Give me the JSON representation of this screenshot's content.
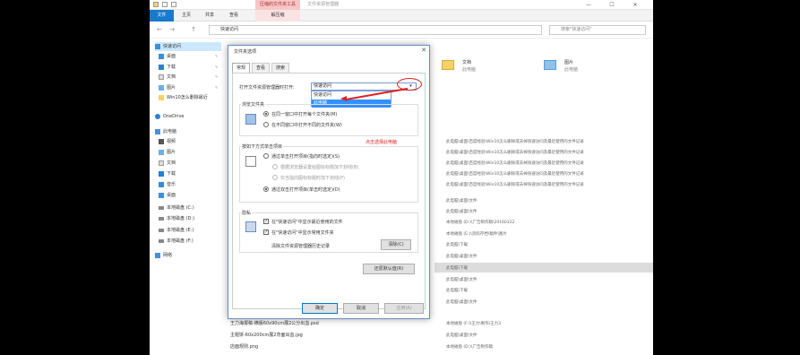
{
  "window": {
    "title": "文件资源管理器",
    "context_tab": "压缩的文件夹工具",
    "min": "—",
    "max": "☐",
    "close": "✕"
  },
  "ribbon": {
    "tabs": [
      "文件",
      "主页",
      "共享",
      "查看",
      "解压缩"
    ]
  },
  "nav": {
    "back": "←",
    "forward": "→",
    "up": "↑",
    "address": "快速访问",
    "search_placeholder": "搜索\"快速访问\""
  },
  "sidebar": {
    "items": [
      {
        "label": "快速访问",
        "pinned": false
      },
      {
        "label": "桌面",
        "pinned": true
      },
      {
        "label": "下载",
        "pinned": true
      },
      {
        "label": "文档",
        "pinned": true
      },
      {
        "label": "图片",
        "pinned": true
      },
      {
        "label": "Win10怎么删除最近",
        "pinned": false
      },
      {
        "label": "OneDrive",
        "pinned": false
      },
      {
        "label": "此电脑",
        "pinned": false
      },
      {
        "label": "视频",
        "pinned": false
      },
      {
        "label": "图片",
        "pinned": false
      },
      {
        "label": "文档",
        "pinned": false
      },
      {
        "label": "下载",
        "pinned": false
      },
      {
        "label": "音乐",
        "pinned": false
      },
      {
        "label": "桌面",
        "pinned": false
      },
      {
        "label": "本地磁盘 (C:)",
        "pinned": false
      },
      {
        "label": "本地磁盘 (D:)",
        "pinned": false
      },
      {
        "label": "本地磁盘 (E:)",
        "pinned": false
      },
      {
        "label": "本地磁盘 (F:)",
        "pinned": false
      },
      {
        "label": "网络",
        "pinned": false
      }
    ]
  },
  "content": {
    "folders": [
      {
        "label": "文档",
        "sub": "此电脑"
      },
      {
        "label": "图片",
        "sub": "此电脑"
      }
    ],
    "paths": [
      "此电脑\\桌面\\百度经验\\Win10怎么删除或去掉快速访问及最近使用的文件记录",
      "此电脑\\桌面\\百度经验\\Win10怎么删除或去掉快速访问及最近使用的文件记录",
      "此电脑\\桌面\\百度经验\\Win10怎么删除或去掉快速访问及最近使用的文件记录",
      "此电脑\\桌面\\百度经验\\Win10怎么删除或去掉快速访问及最近使用的文件记录",
      "此电脑\\桌面\\百度经验\\Win10怎么删除或去掉快速访问及最近使用的文件记录",
      "此电脑\\桌面\\文件",
      "此电脑\\桌面\\文件",
      "本地磁盘 (D:)\\广告制作稿\\20160322",
      "本地磁盘 (E:)\\资料存档\\稿件\\图片",
      "此电脑\\下载",
      "此电脑\\桌面\\文件",
      "此电脑\\下载",
      "此电脑\\桌面\\文件",
      "此电脑\\下载",
      "此电脑\\桌面\\文件",
      "本地磁盘 (F:)\\王力\\制作\\王力3",
      "此电脑\\桌面\\文件",
      "本地磁盘 (D:)\\广告制作稿"
    ],
    "bottom_files": [
      "王力海报稿-横版60x90cm展2公分出血.psd",
      "主题饼-60x200cm展2背面出血.jpg",
      "店面规则.png"
    ]
  },
  "dialog": {
    "title": "文件夹选项",
    "close": "✕",
    "tabs": [
      "常规",
      "查看",
      "搜索"
    ],
    "open_label": "打开文件资源管理器时打开:",
    "combo_value": "快速访问",
    "dropdown_options": [
      "快速访问",
      "此电脑"
    ],
    "annotation": "点击选择此电脑",
    "browse_group": "浏览文件夹",
    "browse_opt1": "在同一窗口中打开每个文件夹(M)",
    "browse_opt2": "在不同窗口中打开不同的文件夹(W)",
    "click_group": "按如下方式单击项目",
    "click_opt1": "通过单击打开项目(指向时选定)(S)",
    "click_sub1": "根据浏览器设置给图标标题加下划线(B)",
    "click_sub2": "仅当指向图标标题时加下划线(P)",
    "click_opt2": "通过双击打开项目(单击时选定)(D)",
    "privacy_group": "隐私",
    "privacy_chk1": "在\"快速访问\"中显示最近使用的文件",
    "privacy_chk2": "在\"快速访问\"中显示常用文件夹",
    "clear_label": "清除文件资源管理器历史记录",
    "clear_btn": "清除(C)",
    "restore_btn": "还原默认值(R)",
    "ok": "确定",
    "cancel": "取消",
    "apply": "应用(A)"
  }
}
